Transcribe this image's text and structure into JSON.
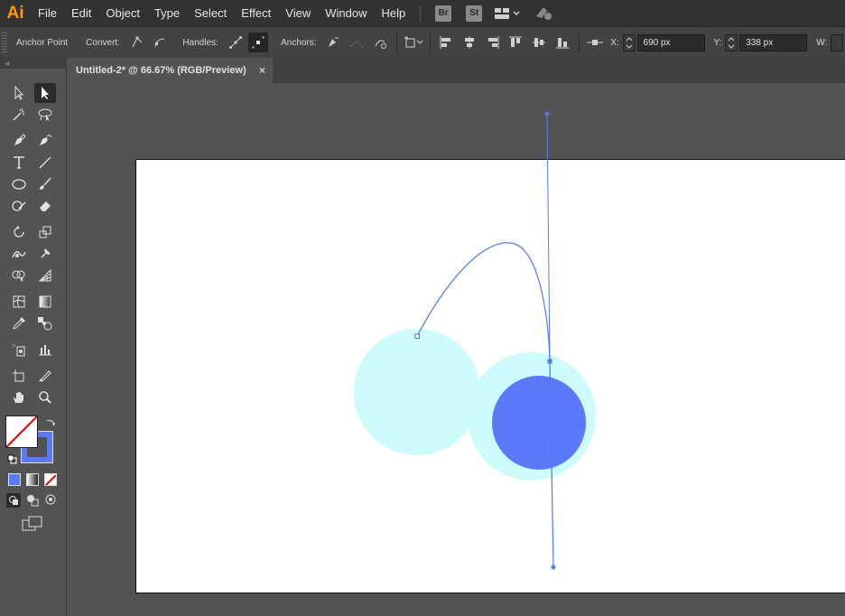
{
  "app": {
    "logo": "Ai"
  },
  "menu": [
    "File",
    "Edit",
    "Object",
    "Type",
    "Select",
    "Effect",
    "View",
    "Window",
    "Help"
  ],
  "bridge_badges": [
    "Br",
    "St"
  ],
  "control_bar": {
    "tool_label": "Anchor Point",
    "convert_label": "Convert:",
    "handles_label": "Handles:",
    "anchors_label": "Anchors:",
    "x_label": "X:",
    "x_value": "690 px",
    "y_label": "Y:",
    "y_value": "338 px",
    "w_label": "W:"
  },
  "panel": {
    "collapse": "«"
  },
  "document_tab": {
    "title": "Untitled-2* @ 66.67% (RGB/Preview)",
    "close": "×"
  },
  "colors": {
    "circle_light": "#cdfbfb",
    "circle_blue": "#5a79fb",
    "path_stroke": "#4d7bec",
    "fill_swatch_blue": "#5a79fb"
  },
  "icons": [
    "selection-icon",
    "direct-selection-icon",
    "magic-wand-icon",
    "lasso-icon",
    "pen-icon",
    "curvature-icon",
    "type-icon",
    "line-icon",
    "ellipse-icon",
    "paintbrush-icon",
    "shaper-icon",
    "eraser-icon",
    "rotate-icon",
    "scale-icon",
    "warp-icon",
    "puppet-warp-icon",
    "shape-builder-icon",
    "perspective-grid-icon",
    "mesh-icon",
    "gradient-icon",
    "eyedropper-icon",
    "blend-icon",
    "symbol-sprayer-icon",
    "column-graph-icon",
    "artboard-icon",
    "slice-icon",
    "hand-icon",
    "zoom-icon"
  ]
}
